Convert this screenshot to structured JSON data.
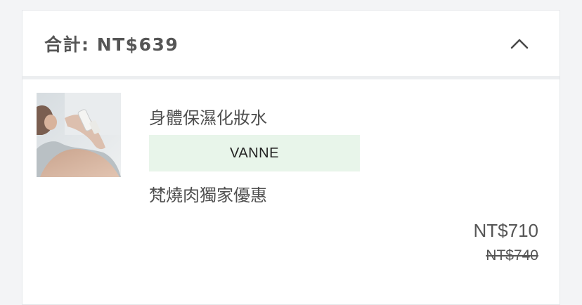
{
  "summary": {
    "total_text": "合計: NT$639",
    "toggle_icon": "chevron-up-icon"
  },
  "item": {
    "name": "身體保濕化妝水",
    "brand": "VANNE",
    "promo": "梵燒肉獨家優惠",
    "price": "NT$710",
    "original_price": "NT$740",
    "image": "product-photo"
  },
  "colors": {
    "page_bg": "#f3f4f6",
    "card_bg": "#ffffff",
    "brand_badge_bg": "#e8f5ea",
    "text": "#4f4f4f"
  }
}
